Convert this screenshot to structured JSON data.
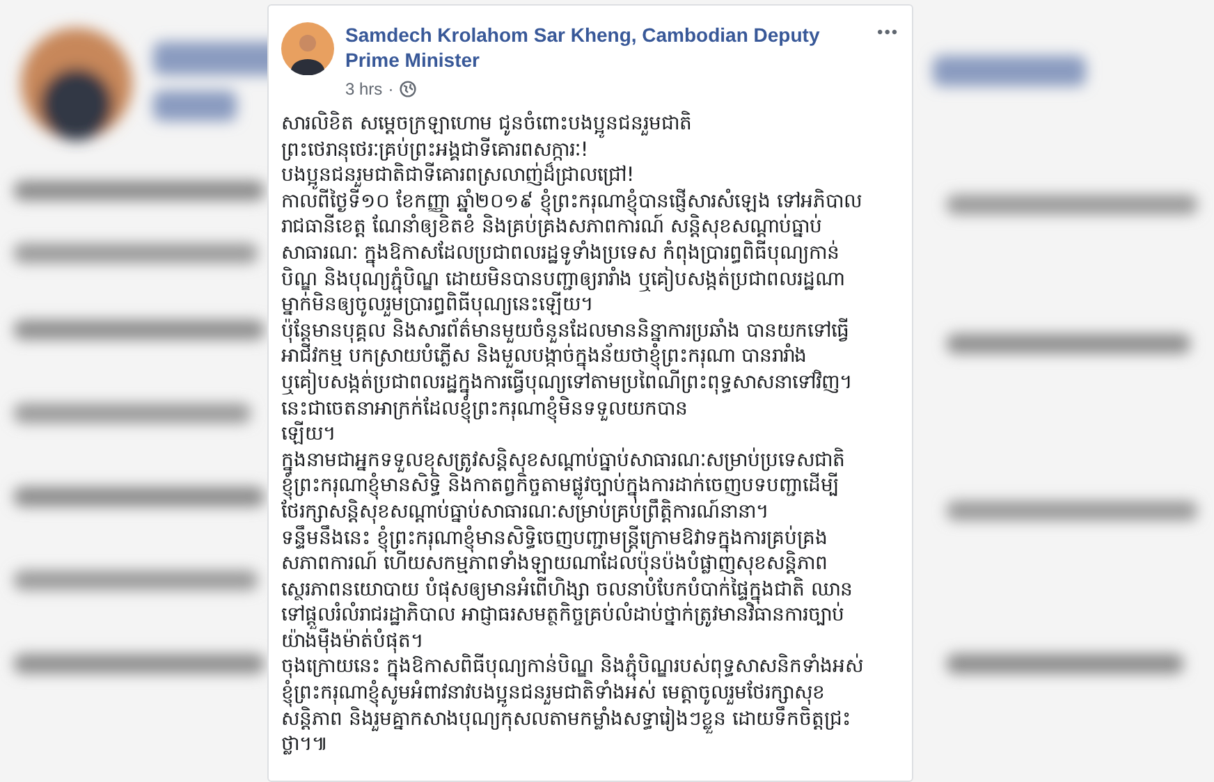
{
  "post": {
    "author": "Samdech Krolahom Sar Kheng, Cambodian Deputy Prime Minister",
    "time": "3 hrs",
    "separator": "·",
    "more": "•••",
    "lines": [
      "សារលិខិត សម្តេចក្រឡាហោម ជូនចំពោះបងប្អូនជនរួមជាតិ",
      "ព្រះថេរានុថេរៈគ្រប់ព្រះអង្គជាទីគោរពសក្ការៈ!",
      "បងប្អូនជនរួមជាតិជាទីគោរពស្រលាញ់ដ៏ជ្រាលជ្រៅ!",
      "កាលពីថ្ងៃទី១០ ខែកញ្ញា ឆ្នាំ២០១៩ ខ្ញុំព្រះករុណាខ្ញុំបានផ្ញើសារសំឡេង ទៅអភិបាល",
      "រាជធានីខេត្ត ណែនាំឲ្យខិតខំ និងគ្រប់គ្រងសភាពការណ៍ សន្តិសុខសណ្តាប់ធ្នាប់",
      "សាធារណៈ ក្នុងឱកាសដែលប្រជាពលរដ្ឋទូទាំងប្រទេស កំពុងប្រារព្ធពិធីបុណ្យកាន់",
      "បិណ្ឌ និងបុណ្យភ្ជុំបិណ្ឌ ដោយមិនបានបញ្ជាឲ្យរារាំង ឬគៀបសង្កត់ប្រជាពលរដ្ឋណា",
      "ម្នាក់មិនឲ្យចូលរួមប្រារព្ធពិធីបុណ្យនេះឡើយ។",
      "ប៉ុន្តែមានបុគ្គល និងសារព័ត៌មានមួយចំនួនដែលមាននិន្នាការប្រឆាំង បានយកទៅធ្វើ",
      "អាជីវកម្ម បកស្រាយបំភ្លើស និងមួលបង្កាច់ក្នុងន័យថាខ្ញុំព្រះករុណា បានរារាំង",
      "ឬគៀបសង្កត់ប្រជាពលរដ្ឋក្នុងការធ្វើបុណ្យទៅតាមប្រពៃណីព្រះពុទ្ធសាសនាទៅវិញ។",
      "នេះជាចេតនាអាក្រក់ដែលខ្ញុំព្រះករុណាខ្ញុំមិនទទួលយកបាន",
      "ឡើយ។",
      "ក្នុងនាមជាអ្នកទទួលខុសត្រូវសន្តិសុខសណ្តាប់ធ្នាប់សាធារណៈសម្រាប់ប្រទេសជាតិ",
      "ខ្ញុំព្រះករុណាខ្ញុំមានសិទ្ធិ និងកាតព្វកិច្ចតាមផ្លូវច្បាប់ក្នុងការដាក់ចេញបទបញ្ជាដើម្បី",
      "ថែរក្សាសន្តិសុខសណ្តាប់ធ្នាប់សាធារណៈសម្រាប់គ្រប់ព្រឹត្តិការណ៍នានា។",
      "ទន្ទឹមនឹងនេះ ខ្ញុំព្រះករុណាខ្ញុំមានសិទ្ធិចេញបញ្ជាមន្ត្រីក្រោមឱវាទក្នុងការគ្រប់គ្រង",
      "សភាពការណ៍ ហើយសកម្មភាពទាំងឡាយណាដែលប៉ុនប៉ងបំផ្លាញសុខសន្តិភាព",
      "ស្ថេរភាពនយោបាយ បំផុសឲ្យមានអំពើហិង្សា ចលនាបំបែកបំបាក់ផ្ទៃក្នុងជាតិ ឈាន",
      "ទៅផ្តួលរំលំរាជរដ្ឋាភិបាល អាជ្ញាធរសមត្ថកិច្ចគ្រប់លំដាប់ថ្នាក់ត្រូវមានវិធានការច្បាប់",
      "យ៉ាងម៉ឺងម៉ាត់បំផុត។",
      "ចុងក្រោយនេះ ក្នុងឱកាសពិធីបុណ្យកាន់បិណ្ឌ និងភ្ជុំបិណ្ឌរបស់ពុទ្ធសាសនិកទាំងអស់",
      "ខ្ញុំព្រះករុណាខ្ញុំសូមអំពាវនាវបងប្អូនជនរួមជាតិទាំងអស់ មេត្តាចូលរួមថែរក្សាសុខ",
      "សន្តិភាព និងរួមគ្នាកសាងបុណ្យកុសលតាមកម្លាំងសទ្ធារៀងៗខ្លួន ដោយទឹកចិត្តជ្រះ",
      "ថ្លា។៕"
    ]
  }
}
